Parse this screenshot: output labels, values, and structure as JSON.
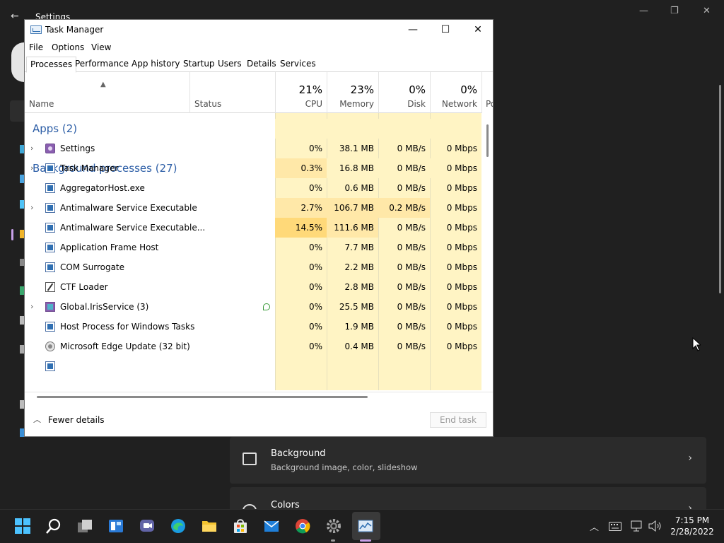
{
  "settings": {
    "title": "Settings",
    "cards": [
      {
        "title": "Background",
        "subtitle": "Background image, color, slideshow"
      },
      {
        "title": "Colors",
        "subtitle": ""
      }
    ]
  },
  "taskmanager": {
    "title": "Task Manager",
    "window_buttons": {
      "minimize": "—",
      "maximize": "☐",
      "close": "✕"
    },
    "menu": [
      "File",
      "Options",
      "View"
    ],
    "tabs": [
      "Processes",
      "Performance",
      "App history",
      "Startup",
      "Users",
      "Details",
      "Services"
    ],
    "columns": {
      "name": "Name",
      "status": "Status",
      "cpu": {
        "pct": "21%",
        "label": "CPU"
      },
      "memory": {
        "pct": "23%",
        "label": "Memory"
      },
      "disk": {
        "pct": "0%",
        "label": "Disk"
      },
      "network": {
        "pct": "0%",
        "label": "Network"
      },
      "power": "Po"
    },
    "groups": {
      "apps": "Apps (2)",
      "background": "Background processes (27)"
    },
    "apps": [
      {
        "name": "Settings",
        "cpu": "0%",
        "memory": "38.1 MB",
        "disk": "0 MB/s",
        "network": "0 Mbps",
        "expandable": true
      },
      {
        "name": "Task Manager",
        "cpu": "0.3%",
        "memory": "16.8 MB",
        "disk": "0 MB/s",
        "network": "0 Mbps",
        "expandable": true
      }
    ],
    "background": [
      {
        "name": "AggregatorHost.exe",
        "cpu": "0%",
        "memory": "0.6 MB",
        "disk": "0 MB/s",
        "network": "0 Mbps",
        "expandable": false
      },
      {
        "name": "Antimalware Service Executable",
        "cpu": "2.7%",
        "memory": "106.7 MB",
        "disk": "0.2 MB/s",
        "network": "0 Mbps",
        "expandable": true
      },
      {
        "name": "Antimalware Service Executable...",
        "cpu": "14.5%",
        "memory": "111.6 MB",
        "disk": "0 MB/s",
        "network": "0 Mbps",
        "expandable": false
      },
      {
        "name": "Application Frame Host",
        "cpu": "0%",
        "memory": "7.7 MB",
        "disk": "0 MB/s",
        "network": "0 Mbps",
        "expandable": false
      },
      {
        "name": "COM Surrogate",
        "cpu": "0%",
        "memory": "2.2 MB",
        "disk": "0 MB/s",
        "network": "0 Mbps",
        "expandable": false
      },
      {
        "name": "CTF Loader",
        "cpu": "0%",
        "memory": "2.8 MB",
        "disk": "0 MB/s",
        "network": "0 Mbps",
        "expandable": false
      },
      {
        "name": "Global.IrisService (3)",
        "cpu": "0%",
        "memory": "25.5 MB",
        "disk": "0 MB/s",
        "network": "0 Mbps",
        "expandable": true
      },
      {
        "name": "Host Process for Windows Tasks",
        "cpu": "0%",
        "memory": "1.9 MB",
        "disk": "0 MB/s",
        "network": "0 Mbps",
        "expandable": false
      },
      {
        "name": "Microsoft Edge Update (32 bit)",
        "cpu": "0%",
        "memory": "0.4 MB",
        "disk": "0 MB/s",
        "network": "0 Mbps",
        "expandable": false
      }
    ],
    "footer": {
      "fewer_details": "Fewer details",
      "end_task": "End task"
    }
  },
  "taskbar": {
    "time": "7:15 PM",
    "date": "2/28/2022"
  },
  "colors": {
    "accent": "#2e5fa7",
    "heat_light": "#fff4c4",
    "heat_mid": "#ffe8a8",
    "heat_strong": "#ffd979"
  }
}
